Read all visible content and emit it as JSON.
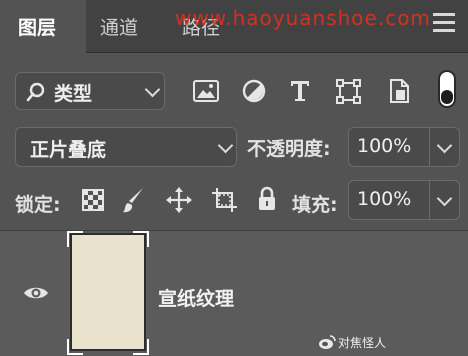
{
  "tabs": [
    {
      "label": "图层",
      "active": true
    },
    {
      "label": "通道",
      "active": false
    },
    {
      "label": "路径",
      "active": false
    }
  ],
  "watermark": "www.haoyuanshoe.com",
  "filter": {
    "icon": "search-icon",
    "label": "类型"
  },
  "filter_icons": [
    "image-filter-icon",
    "adjustment-filter-icon",
    "text-filter-icon",
    "shape-filter-icon",
    "smart-object-filter-icon"
  ],
  "blend_mode": "正片叠底",
  "opacity": {
    "label": "不透明度:",
    "value": "100%"
  },
  "lock": {
    "label": "锁定:",
    "icons": [
      "lock-transparent-pixels-icon",
      "lock-image-pixels-icon",
      "lock-position-icon",
      "lock-artboard-icon",
      "lock-all-icon"
    ]
  },
  "fill": {
    "label": "填充:",
    "value": "100%"
  },
  "layer": {
    "name": "宣纸纹理",
    "visible": true
  },
  "credit": "对焦怪人",
  "colors": {
    "panel": "#535353",
    "tabbar": "#424242",
    "layer_row": "#5b5b5b",
    "watermark": "#e0301e",
    "thumbnail": "#e9e2cd"
  }
}
